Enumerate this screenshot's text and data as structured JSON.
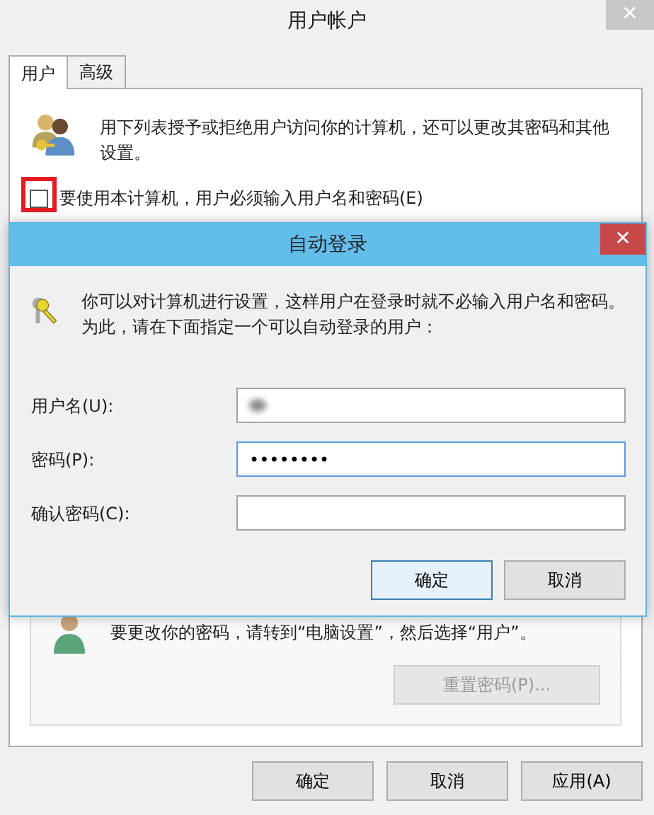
{
  "window": {
    "title": "用户帐户",
    "close": "✕"
  },
  "tabs": [
    {
      "label": "用户",
      "selected": true
    },
    {
      "label": "高级",
      "selected": false
    }
  ],
  "intro": "用下列表授予或拒绝用户访问你的计算机，还可以更改其密码和其他设置。",
  "require_password": {
    "label": "要使用本计算机，用户必须输入用户名和密码(E)",
    "checked": false,
    "highlighted": true
  },
  "password_note": "要更改你的密码，请转到“电脑设置”，然后选择“用户”。",
  "reset_button": {
    "label": "重置密码(P)...",
    "disabled": true
  },
  "buttons": [
    {
      "label": "确定"
    },
    {
      "label": "取消"
    },
    {
      "label": "应用(A)"
    }
  ],
  "dialog": {
    "title": "自动登录",
    "close": "✕",
    "text": "你可以对计算机进行设置，这样用户在登录时就不必输入用户名和密码。为此，请在下面指定一个可以自动登录的用户：",
    "fields": [
      {
        "label": "用户名(U):",
        "kind": "redacted",
        "focused": false
      },
      {
        "label": "密码(P):",
        "value": "••••••••",
        "kind": "text",
        "focused": true
      },
      {
        "label": "确认密码(C):",
        "kind": "text",
        "focused": false
      }
    ],
    "buttons": [
      {
        "label": "确定",
        "default": true
      },
      {
        "label": "取消",
        "default": false
      }
    ]
  }
}
